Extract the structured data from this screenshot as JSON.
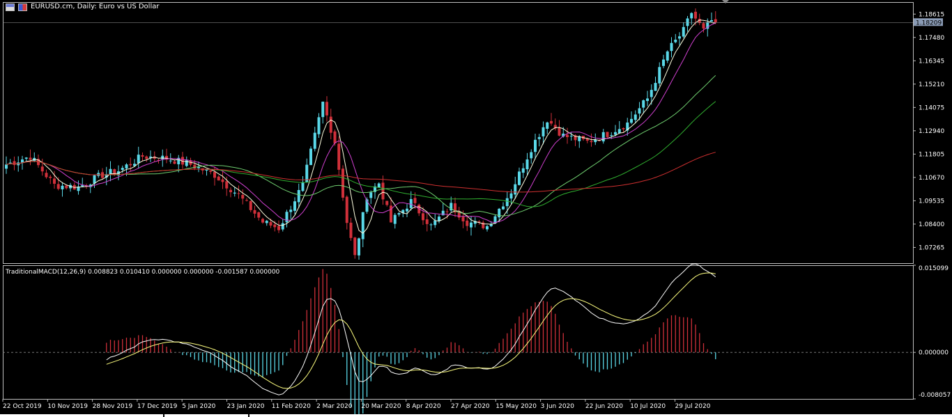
{
  "header": {
    "symbol_title": "EURUSD.cm, Daily:  Euro vs US Dollar",
    "icons": [
      "chart-window-icon",
      "flag-icon"
    ]
  },
  "colors": {
    "background": "#000000",
    "frame": "#c0c0c0",
    "bull_candle": "#5ad8e8",
    "bear_candle": "#d0303a",
    "ma_fast": "#ffffe0",
    "ma_mid": "#d040d0",
    "ma_slow1": "#70d070",
    "ma_slow2": "#30b030",
    "ma_long": "#d03030",
    "macd_line": "#ffffff",
    "signal_line": "#ffff80",
    "price_tag": "#8a9bb5"
  },
  "chart_data": [
    {
      "type": "candlestick",
      "title": "EURUSD.cm, Daily:  Euro vs US Dollar",
      "y_ticks": [
        "1.18615",
        "1.17480",
        "1.16345",
        "1.15210",
        "1.14075",
        "1.12940",
        "1.11805",
        "1.10670",
        "1.09535",
        "1.08400",
        "1.07265"
      ],
      "ylim": [
        1.065,
        1.192
      ],
      "current_price": "1.18209",
      "x_labels": [
        "22 Oct 2019",
        "10 Nov 2019",
        "28 Nov 2019",
        "17 Dec 2019",
        "5 Jan 2020",
        "23 Jan 2020",
        "11 Feb 2020",
        "2 Mar 2020",
        "20 Mar 2020",
        "8 Apr 2020",
        "27 Apr 2020",
        "15 May 2020",
        "3 Jun 2020",
        "22 Jun 2020",
        "10 Jul 2020",
        "29 Jul 2020"
      ],
      "close_anchors": [
        [
          0,
          1.113
        ],
        [
          6,
          1.117
        ],
        [
          12,
          1.103
        ],
        [
          18,
          1.102
        ],
        [
          24,
          1.108
        ],
        [
          28,
          1.11
        ],
        [
          34,
          1.117
        ],
        [
          40,
          1.116
        ],
        [
          46,
          1.113
        ],
        [
          52,
          1.108
        ],
        [
          58,
          1.098
        ],
        [
          64,
          1.085
        ],
        [
          68,
          1.082
        ],
        [
          74,
          1.103
        ],
        [
          79,
          1.143
        ],
        [
          82,
          1.124
        ],
        [
          85,
          1.085
        ],
        [
          87,
          1.068
        ],
        [
          90,
          1.098
        ],
        [
          93,
          1.104
        ],
        [
          96,
          1.085
        ],
        [
          101,
          1.095
        ],
        [
          106,
          1.083
        ],
        [
          111,
          1.093
        ],
        [
          115,
          1.085
        ],
        [
          120,
          1.083
        ],
        [
          126,
          1.1
        ],
        [
          131,
          1.121
        ],
        [
          135,
          1.135
        ],
        [
          139,
          1.127
        ],
        [
          145,
          1.124
        ],
        [
          150,
          1.128
        ],
        [
          155,
          1.133
        ],
        [
          160,
          1.145
        ],
        [
          165,
          1.168
        ],
        [
          169,
          1.178
        ],
        [
          171,
          1.187
        ],
        [
          174,
          1.178
        ],
        [
          176,
          1.183
        ],
        [
          177,
          1.182
        ]
      ],
      "moving_averages": [
        {
          "period": 5,
          "color": "#ffffe0"
        },
        {
          "period": 10,
          "color": "#d040d0"
        },
        {
          "period": 30,
          "color": "#70d070"
        },
        {
          "period": 50,
          "color": "#30b030"
        },
        {
          "period": 100,
          "color": "#d03030"
        }
      ]
    },
    {
      "type": "macd",
      "title": "TraditionalMACD(12,26,9) 0.008823 0.010410 0.000000 0.000000 -0.001587 0.000000",
      "params": [
        12,
        26,
        9
      ],
      "values": {
        "macd": 0.008823,
        "signal": 0.01041,
        "histogram": -0.001587
      },
      "y_ticks": [
        "0.015099",
        "0.000000",
        "-0.008057"
      ],
      "ylim": [
        -0.008057,
        0.015099
      ],
      "zero_line": "dashed"
    }
  ]
}
